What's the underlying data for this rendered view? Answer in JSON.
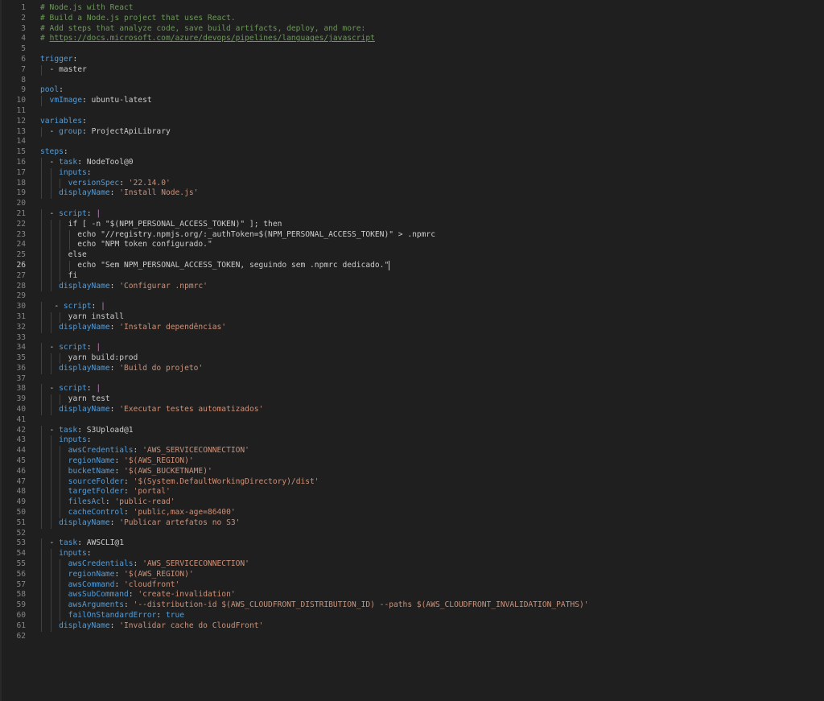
{
  "editor": {
    "language": "yaml",
    "active_line": 26,
    "colors": {
      "background": "#1f1f1f",
      "line_number": "#858585",
      "comment": "#6a9955",
      "key": "#569cd6",
      "string": "#ce9178",
      "text": "#cccccc"
    },
    "lines": [
      {
        "n": "1",
        "indent": 0,
        "tokens": [
          {
            "t": "# Node.js with React",
            "c": "comment"
          }
        ]
      },
      {
        "n": "2",
        "indent": 0,
        "tokens": [
          {
            "t": "# Build a Node.js project that uses React.",
            "c": "comment"
          }
        ]
      },
      {
        "n": "3",
        "indent": 0,
        "tokens": [
          {
            "t": "# Add steps that analyze code, save build artifacts, deploy, and more:",
            "c": "comment"
          }
        ]
      },
      {
        "n": "4",
        "indent": 0,
        "tokens": [
          {
            "t": "# ",
            "c": "comment"
          },
          {
            "t": "https://docs.microsoft.com/azure/devops/pipelines/languages/javascript",
            "c": "url"
          }
        ]
      },
      {
        "n": "5",
        "indent": 0,
        "tokens": []
      },
      {
        "n": "6",
        "indent": 0,
        "tokens": [
          {
            "t": "trigger",
            "c": "key"
          },
          {
            "t": ":",
            "c": "punct"
          }
        ]
      },
      {
        "n": "7",
        "indent": 1,
        "tokens": [
          {
            "t": "- ",
            "c": "punct"
          },
          {
            "t": "master",
            "c": "val"
          }
        ]
      },
      {
        "n": "8",
        "indent": 0,
        "tokens": []
      },
      {
        "n": "9",
        "indent": 0,
        "tokens": [
          {
            "t": "pool",
            "c": "key"
          },
          {
            "t": ":",
            "c": "punct"
          }
        ]
      },
      {
        "n": "10",
        "indent": 1,
        "tokens": [
          {
            "t": "vmImage",
            "c": "key"
          },
          {
            "t": ": ",
            "c": "punct"
          },
          {
            "t": "ubuntu-latest",
            "c": "val"
          }
        ]
      },
      {
        "n": "11",
        "indent": 0,
        "tokens": []
      },
      {
        "n": "12",
        "indent": 0,
        "tokens": [
          {
            "t": "variables",
            "c": "key"
          },
          {
            "t": ":",
            "c": "punct"
          }
        ]
      },
      {
        "n": "13",
        "indent": 1,
        "tokens": [
          {
            "t": "- ",
            "c": "punct"
          },
          {
            "t": "group",
            "c": "key"
          },
          {
            "t": ": ",
            "c": "punct"
          },
          {
            "t": "ProjectApiLibrary",
            "c": "val"
          }
        ]
      },
      {
        "n": "14",
        "indent": 0,
        "tokens": []
      },
      {
        "n": "15",
        "indent": 0,
        "tokens": [
          {
            "t": "steps",
            "c": "key"
          },
          {
            "t": ":",
            "c": "punct"
          }
        ]
      },
      {
        "n": "16",
        "indent": 1,
        "tokens": [
          {
            "t": "- ",
            "c": "punct"
          },
          {
            "t": "task",
            "c": "key"
          },
          {
            "t": ": ",
            "c": "punct"
          },
          {
            "t": "NodeTool@0",
            "c": "val"
          }
        ]
      },
      {
        "n": "17",
        "indent": 2,
        "tokens": [
          {
            "t": "inputs",
            "c": "key"
          },
          {
            "t": ":",
            "c": "punct"
          }
        ]
      },
      {
        "n": "18",
        "indent": 3,
        "tokens": [
          {
            "t": "versionSpec",
            "c": "key"
          },
          {
            "t": ": ",
            "c": "punct"
          },
          {
            "t": "'22.14.0'",
            "c": "str"
          }
        ]
      },
      {
        "n": "19",
        "indent": 2,
        "tokens": [
          {
            "t": "displayName",
            "c": "key"
          },
          {
            "t": ": ",
            "c": "punct"
          },
          {
            "t": "'Install Node.js'",
            "c": "str"
          }
        ]
      },
      {
        "n": "20",
        "indent": 0,
        "tokens": []
      },
      {
        "n": "21",
        "indent": 1,
        "tokens": [
          {
            "t": "- ",
            "c": "punct"
          },
          {
            "t": "script",
            "c": "key"
          },
          {
            "t": ": ",
            "c": "punct"
          },
          {
            "t": "|",
            "c": "pipe"
          }
        ]
      },
      {
        "n": "22",
        "indent": 3,
        "tokens": [
          {
            "t": "if [ -n \"$(NPM_PERSONAL_ACCESS_TOKEN)\" ]; then",
            "c": "val"
          }
        ]
      },
      {
        "n": "23",
        "indent": 4,
        "tokens": [
          {
            "t": "echo \"//registry.npmjs.org/:_authToken=$(NPM_PERSONAL_ACCESS_TOKEN)\" > .npmrc",
            "c": "val"
          }
        ]
      },
      {
        "n": "24",
        "indent": 4,
        "tokens": [
          {
            "t": "echo \"NPM token configurado.\"",
            "c": "val"
          }
        ]
      },
      {
        "n": "25",
        "indent": 3,
        "tokens": [
          {
            "t": "else",
            "c": "val"
          }
        ]
      },
      {
        "n": "26",
        "indent": 4,
        "tokens": [
          {
            "t": "echo \"Sem NPM_PERSONAL_ACCESS_TOKEN, seguindo sem .npmrc dedicado.\"",
            "c": "val"
          }
        ],
        "caret": true
      },
      {
        "n": "27",
        "indent": 3,
        "tokens": [
          {
            "t": "fi",
            "c": "val"
          }
        ]
      },
      {
        "n": "28",
        "indent": 2,
        "tokens": [
          {
            "t": "displayName",
            "c": "key"
          },
          {
            "t": ": ",
            "c": "punct"
          },
          {
            "t": "'Configurar .npmrc'",
            "c": "str"
          }
        ]
      },
      {
        "n": "29",
        "indent": 0,
        "tokens": []
      },
      {
        "n": "30",
        "indent": 1,
        "lead": " ",
        "tokens": [
          {
            "t": "- ",
            "c": "punct"
          },
          {
            "t": "script",
            "c": "key"
          },
          {
            "t": ": ",
            "c": "punct"
          },
          {
            "t": "|",
            "c": "pipe"
          }
        ]
      },
      {
        "n": "31",
        "indent": 3,
        "tokens": [
          {
            "t": "yarn install",
            "c": "val"
          }
        ]
      },
      {
        "n": "32",
        "indent": 2,
        "tokens": [
          {
            "t": "displayName",
            "c": "key"
          },
          {
            "t": ": ",
            "c": "punct"
          },
          {
            "t": "'Instalar dependências'",
            "c": "str"
          }
        ]
      },
      {
        "n": "33",
        "indent": 0,
        "tokens": []
      },
      {
        "n": "34",
        "indent": 1,
        "tokens": [
          {
            "t": "- ",
            "c": "punct"
          },
          {
            "t": "script",
            "c": "key"
          },
          {
            "t": ": ",
            "c": "punct"
          },
          {
            "t": "|",
            "c": "pipe"
          }
        ]
      },
      {
        "n": "35",
        "indent": 3,
        "tokens": [
          {
            "t": "yarn build:prod",
            "c": "val"
          }
        ]
      },
      {
        "n": "36",
        "indent": 2,
        "tokens": [
          {
            "t": "displayName",
            "c": "key"
          },
          {
            "t": ": ",
            "c": "punct"
          },
          {
            "t": "'Build do projeto'",
            "c": "str"
          }
        ]
      },
      {
        "n": "37",
        "indent": 0,
        "tokens": []
      },
      {
        "n": "38",
        "indent": 1,
        "tokens": [
          {
            "t": "- ",
            "c": "punct"
          },
          {
            "t": "script",
            "c": "key"
          },
          {
            "t": ": ",
            "c": "punct"
          },
          {
            "t": "|",
            "c": "pipe"
          }
        ]
      },
      {
        "n": "39",
        "indent": 3,
        "tokens": [
          {
            "t": "yarn test",
            "c": "val"
          }
        ]
      },
      {
        "n": "40",
        "indent": 2,
        "tokens": [
          {
            "t": "displayName",
            "c": "key"
          },
          {
            "t": ": ",
            "c": "punct"
          },
          {
            "t": "'Executar testes automatizados'",
            "c": "str"
          }
        ]
      },
      {
        "n": "41",
        "indent": 0,
        "tokens": []
      },
      {
        "n": "42",
        "indent": 1,
        "tokens": [
          {
            "t": "- ",
            "c": "punct"
          },
          {
            "t": "task",
            "c": "key"
          },
          {
            "t": ": ",
            "c": "punct"
          },
          {
            "t": "S3Upload@1",
            "c": "val"
          }
        ]
      },
      {
        "n": "43",
        "indent": 2,
        "tokens": [
          {
            "t": "inputs",
            "c": "key"
          },
          {
            "t": ":",
            "c": "punct"
          }
        ]
      },
      {
        "n": "44",
        "indent": 3,
        "tokens": [
          {
            "t": "awsCredentials",
            "c": "key"
          },
          {
            "t": ": ",
            "c": "punct"
          },
          {
            "t": "'AWS_SERVICECONNECTION'",
            "c": "str"
          }
        ]
      },
      {
        "n": "45",
        "indent": 3,
        "tokens": [
          {
            "t": "regionName",
            "c": "key"
          },
          {
            "t": ": ",
            "c": "punct"
          },
          {
            "t": "'$(AWS_REGION)'",
            "c": "str"
          }
        ]
      },
      {
        "n": "46",
        "indent": 3,
        "tokens": [
          {
            "t": "bucketName",
            "c": "key"
          },
          {
            "t": ": ",
            "c": "punct"
          },
          {
            "t": "'$(AWS_BUCKETNAME)'",
            "c": "str"
          }
        ]
      },
      {
        "n": "47",
        "indent": 3,
        "tokens": [
          {
            "t": "sourceFolder",
            "c": "key"
          },
          {
            "t": ": ",
            "c": "punct"
          },
          {
            "t": "'$(System.DefaultWorkingDirectory)/dist'",
            "c": "str"
          }
        ]
      },
      {
        "n": "48",
        "indent": 3,
        "tokens": [
          {
            "t": "targetFolder",
            "c": "key"
          },
          {
            "t": ": ",
            "c": "punct"
          },
          {
            "t": "'portal'",
            "c": "str"
          }
        ]
      },
      {
        "n": "49",
        "indent": 3,
        "tokens": [
          {
            "t": "filesAcl",
            "c": "key"
          },
          {
            "t": ": ",
            "c": "punct"
          },
          {
            "t": "'public-read'",
            "c": "str"
          }
        ]
      },
      {
        "n": "50",
        "indent": 3,
        "tokens": [
          {
            "t": "cacheControl",
            "c": "key"
          },
          {
            "t": ": ",
            "c": "punct"
          },
          {
            "t": "'public,max-age=86400'",
            "c": "str"
          }
        ]
      },
      {
        "n": "51",
        "indent": 2,
        "tokens": [
          {
            "t": "displayName",
            "c": "key"
          },
          {
            "t": ": ",
            "c": "punct"
          },
          {
            "t": "'Publicar artefatos no S3'",
            "c": "str"
          }
        ]
      },
      {
        "n": "52",
        "indent": 0,
        "tokens": []
      },
      {
        "n": "53",
        "indent": 1,
        "tokens": [
          {
            "t": "- ",
            "c": "punct"
          },
          {
            "t": "task",
            "c": "key"
          },
          {
            "t": ": ",
            "c": "punct"
          },
          {
            "t": "AWSCLI@1",
            "c": "val"
          }
        ]
      },
      {
        "n": "54",
        "indent": 2,
        "tokens": [
          {
            "t": "inputs",
            "c": "key"
          },
          {
            "t": ":",
            "c": "punct"
          }
        ]
      },
      {
        "n": "55",
        "indent": 3,
        "tokens": [
          {
            "t": "awsCredentials",
            "c": "key"
          },
          {
            "t": ": ",
            "c": "punct"
          },
          {
            "t": "'AWS_SERVICECONNECTION'",
            "c": "str"
          }
        ]
      },
      {
        "n": "56",
        "indent": 3,
        "tokens": [
          {
            "t": "regionName",
            "c": "key"
          },
          {
            "t": ": ",
            "c": "punct"
          },
          {
            "t": "'$(AWS_REGION)'",
            "c": "str"
          }
        ]
      },
      {
        "n": "57",
        "indent": 3,
        "tokens": [
          {
            "t": "awsCommand",
            "c": "key"
          },
          {
            "t": ": ",
            "c": "punct"
          },
          {
            "t": "'cloudfront'",
            "c": "str"
          }
        ]
      },
      {
        "n": "58",
        "indent": 3,
        "tokens": [
          {
            "t": "awsSubCommand",
            "c": "key"
          },
          {
            "t": ": ",
            "c": "punct"
          },
          {
            "t": "'create-invalidation'",
            "c": "str"
          }
        ]
      },
      {
        "n": "59",
        "indent": 3,
        "tokens": [
          {
            "t": "awsArguments",
            "c": "key"
          },
          {
            "t": ": ",
            "c": "punct"
          },
          {
            "t": "'--distribution-id $(AWS_CLOUDFRONT_DISTRIBUTION_ID) --paths $(AWS_CLOUDFRONT_INVALIDATION_PATHS)'",
            "c": "str"
          }
        ]
      },
      {
        "n": "60",
        "indent": 3,
        "tokens": [
          {
            "t": "failOnStandardError",
            "c": "key"
          },
          {
            "t": ": ",
            "c": "punct"
          },
          {
            "t": "true",
            "c": "bool"
          }
        ]
      },
      {
        "n": "61",
        "indent": 2,
        "tokens": [
          {
            "t": "displayName",
            "c": "key"
          },
          {
            "t": ": ",
            "c": "punct"
          },
          {
            "t": "'Invalidar cache do CloudFront'",
            "c": "str"
          }
        ]
      },
      {
        "n": "62",
        "indent": 0,
        "tokens": []
      }
    ]
  }
}
